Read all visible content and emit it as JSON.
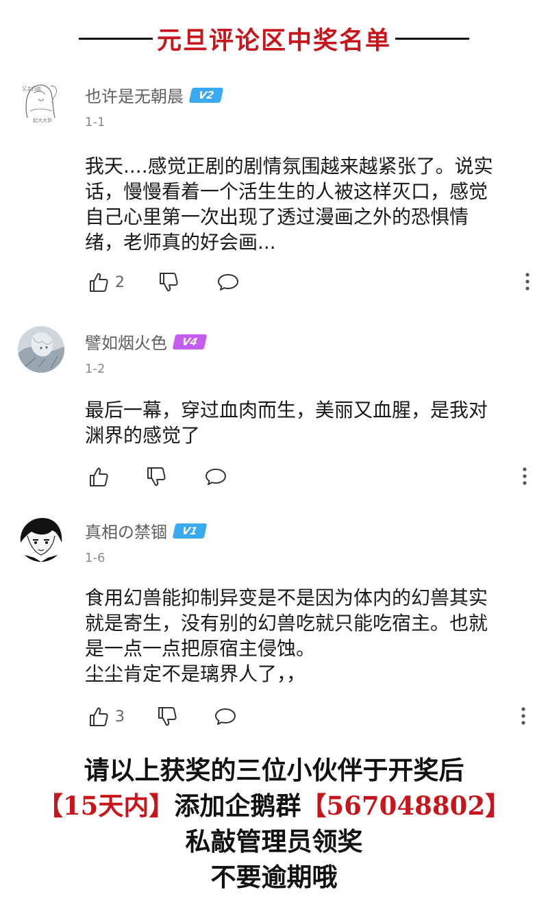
{
  "header": {
    "title": "元旦评论区中奖名单"
  },
  "comments": [
    {
      "username": "也许是无朝晨",
      "level": "V2",
      "level_color": "#39a9f0",
      "date": "1-1",
      "content": [
        "我天....感觉正剧的剧情氛围越来越紧张了。说实",
        "话，慢慢看着一个活生生的人被这样灭口，感觉",
        "自己心里第一次出现了透过漫画之外的恐惧情",
        "绪，老师真的好会画..."
      ],
      "likes": "2",
      "avatar_icon": "sketch-avatar",
      "avatar_text": [
        "又主行路",
        "起大大到"
      ]
    },
    {
      "username": "譬如烟火色",
      "level": "V4",
      "level_color": "#c55cf0",
      "date": "1-2",
      "content": [
        "最后一幕，穿过血肉而生，美丽又血腥，是我对",
        "渊界的感觉了"
      ],
      "likes": "",
      "avatar_icon": "anime-avatar"
    },
    {
      "username": "真相の禁锢",
      "level": "V1",
      "level_color": "#39a9f0",
      "date": "1-6",
      "content": [
        "食用幻兽能抑制异变是不是因为体内的幻兽其实",
        "就是寄生，没有别的幻兽吃就只能吃宿主。也就",
        "是一点一点把原宿主侵蚀。",
        "尘尘肯定不是璃界人了，，"
      ],
      "likes": "3",
      "avatar_icon": "manga-avatar"
    }
  ],
  "footer": {
    "line1": "请以上获奖的三位小伙伴于开奖后",
    "line2_red_a": "【15天内】",
    "line2_black": "添加企鹅群",
    "line2_red_b": "【567048802】",
    "line3": "私敲管理员领奖",
    "line4": "不要逾期哦"
  }
}
